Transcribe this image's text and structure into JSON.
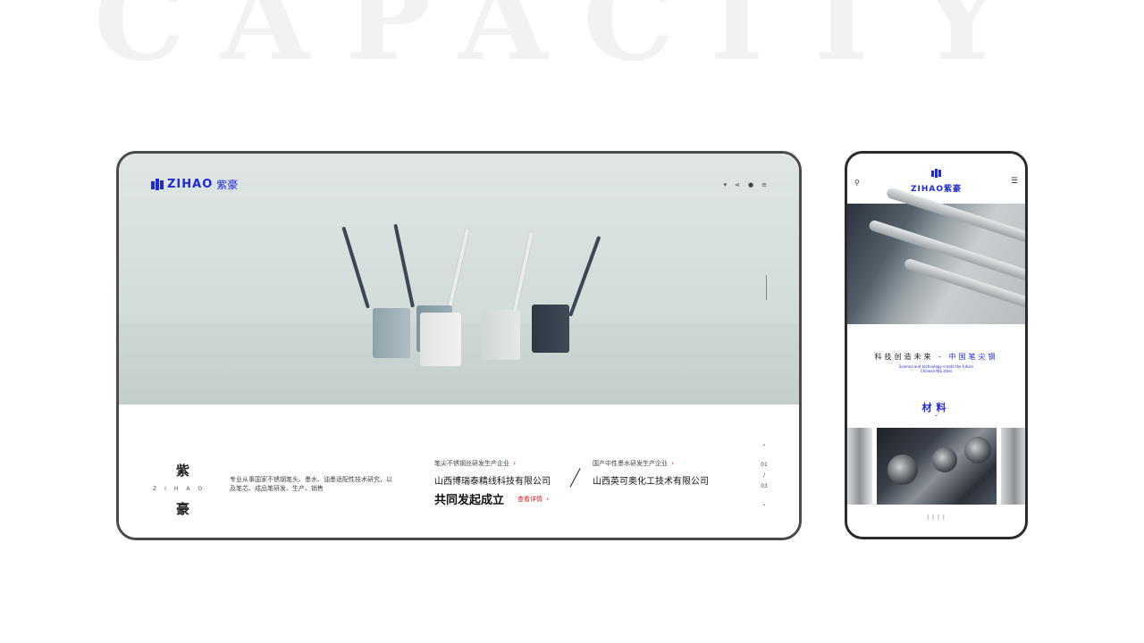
{
  "background_word": "CAPACITY",
  "desktop": {
    "logo": {
      "text": "ZIHAO",
      "cn": "紫豪"
    },
    "nav_icons": [
      "cart-icon",
      "share-icon",
      "user-icon",
      "menu-icon"
    ],
    "brand": {
      "cn1": "紫",
      "en": "ZIHAO",
      "cn2": "豪"
    },
    "description": "专业从事国家不锈钢笔头、墨水、油墨适配性技术研究，以及笔芯、成品笔研发、生产、销售",
    "company1": {
      "tag": "笔尖不锈钢丝研发生产企业",
      "name": "山西博瑞泰精线科技有限公司"
    },
    "headline": "共同发起成立",
    "more_link": "查看详情",
    "company2": {
      "tag": "国产中性墨水研发生产企业",
      "name": "山西英可奥化工技术有限公司"
    },
    "pager": {
      "up": "⌃",
      "current": "01",
      "sep": "/",
      "total": "03",
      "down": "⌄"
    }
  },
  "mobile": {
    "logo": "ZIHAO紫豪",
    "slogan_left": "科技创造未来",
    "slogan_sep": "-",
    "slogan_right": "中国笔尖钢",
    "slogan_en": "Science and technology create the future",
    "slogan_en2": "Chinese NIb steel",
    "section_title": "材料",
    "section_chevron": "⌄",
    "pager": "| | | |"
  },
  "colors": {
    "brand_blue": "#1f2ad6",
    "accent_red": "#d2232a",
    "frame": "#4a4a4a"
  }
}
